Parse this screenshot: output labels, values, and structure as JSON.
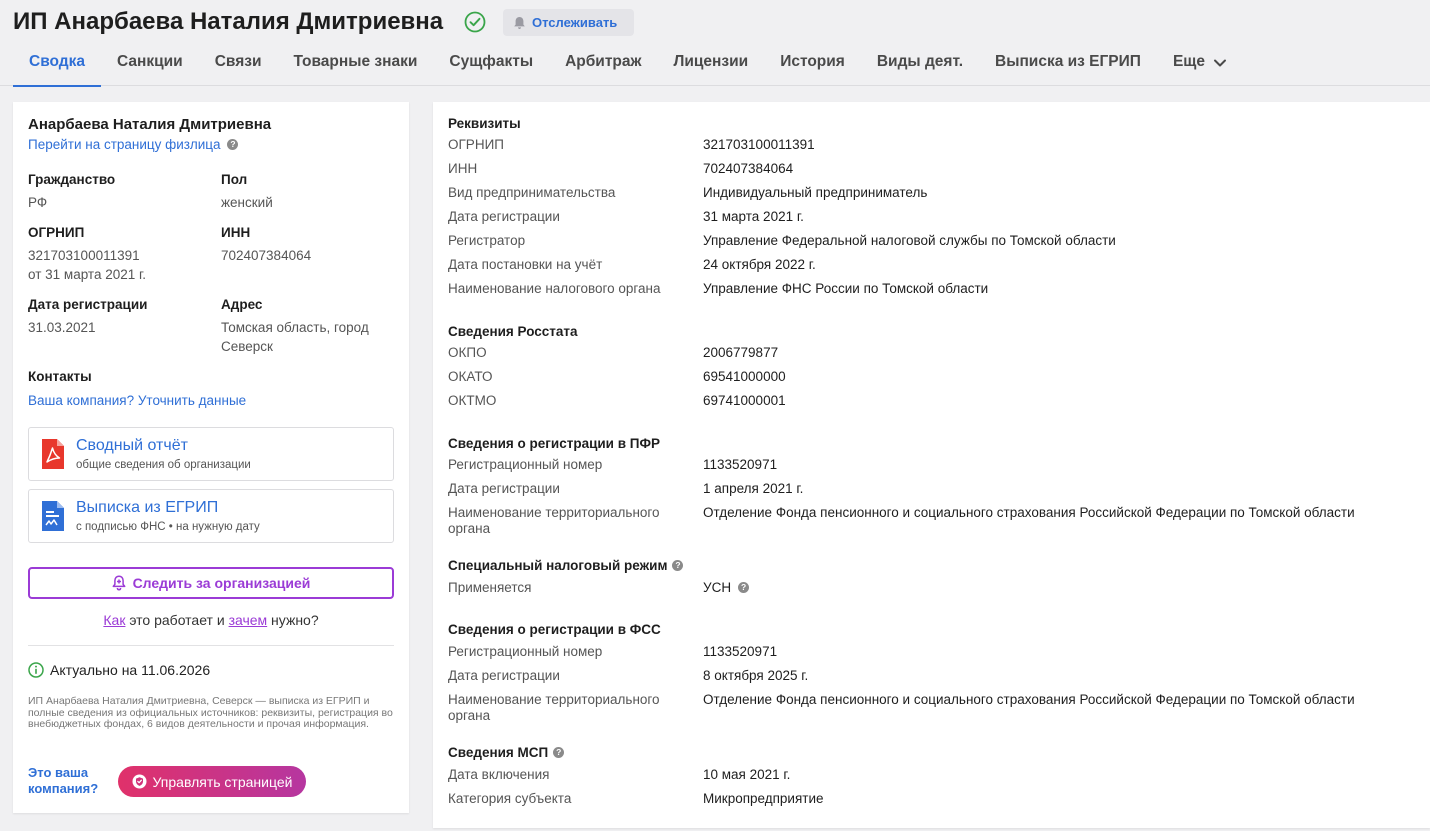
{
  "header": {
    "title": "ИП Анарбаева Наталия Дмитриевна",
    "track_label": "Отслеживать",
    "tabs": [
      "Сводка",
      "Санкции",
      "Связи",
      "Товарные знаки",
      "Сущфакты",
      "Арбитраж",
      "Лицензии",
      "История",
      "Виды деят.",
      "Выписка из ЕГРИП",
      "Еще"
    ],
    "active_tab": "Сводка"
  },
  "left": {
    "person_name": "Анарбаева Наталия Дмитриевна",
    "person_link": "Перейти на страницу физлица",
    "citizenship_label": "Гражданство",
    "citizenship_value": "РФ",
    "gender_label": "Пол",
    "gender_value": "женский",
    "ogrnip_label": "ОГРНИП",
    "ogrnip_value": "321703100011391",
    "ogrnip_date": "от 31 марта 2021 г.",
    "inn_label": "ИНН",
    "inn_value": "702407384064",
    "regdate_label": "Дата регистрации",
    "regdate_value": "31.03.2021",
    "address_label": "Адрес",
    "address_value": "Томская область, город Северск",
    "contacts_title": "Контакты",
    "contacts_link": "Ваша компания? Уточнить данные",
    "doc1_title": "Сводный отчёт",
    "doc1_sub": "общие сведения об организации",
    "doc2_title": "Выписка из ЕГРИП",
    "doc2_sub": "с подписью ФНС • на нужную дату",
    "follow_label": "Следить за организацией",
    "how_part1": "Как",
    "how_part2": " это работает и ",
    "how_part3": "зачем",
    "how_part4": " нужно?",
    "actual_text": "Актуально на 11.06.2026",
    "description": "ИП Анарбаева Наталия Дмитриевна, Северск — выписка из ЕГРИП и полные сведения из официальных источников: реквизиты, регистрация во внебюджетных фондах, 6 видов деятельности и прочая информация.",
    "own_question": "Это ваша компания?",
    "manage_label": "Управлять страницей"
  },
  "right": {
    "requisites": {
      "title": "Реквизиты",
      "rows": [
        {
          "label": "ОГРНИП",
          "value": "321703100011391"
        },
        {
          "label": "ИНН",
          "value": "702407384064"
        },
        {
          "label": "Вид предпринимательства",
          "value": "Индивидуальный предприниматель"
        },
        {
          "label": "Дата регистрации",
          "value": "31 марта 2021 г."
        },
        {
          "label": "Регистратор",
          "value": "Управление Федеральной налоговой службы по Томской области"
        },
        {
          "label": "Дата постановки на учёт",
          "value": "24 октября 2022 г."
        },
        {
          "label": "Наименование налогового органа",
          "value": "Управление ФНС России по Томской области"
        }
      ]
    },
    "rosstat": {
      "title": "Сведения Росстата",
      "rows": [
        {
          "label": "ОКПО",
          "value": "2006779877"
        },
        {
          "label": "ОКАТО",
          "value": "69541000000"
        },
        {
          "label": "ОКТМО",
          "value": "69741000001"
        }
      ]
    },
    "pfr": {
      "title": "Сведения о регистрации в ПФР",
      "rows": [
        {
          "label": "Регистрационный номер",
          "value": "1133520971"
        },
        {
          "label": "Дата регистрации",
          "value": "1 апреля 2021 г."
        },
        {
          "label": "Наименование территориального органа",
          "value": "Отделение Фонда пенсионного и социального страхования Российской Федерации по Томской области"
        }
      ]
    },
    "tax": {
      "title": "Специальный налоговый режим",
      "rows": [
        {
          "label": "Применяется",
          "value": "УСН"
        }
      ]
    },
    "fss": {
      "title": "Сведения о регистрации в ФСС",
      "rows": [
        {
          "label": "Регистрационный номер",
          "value": "1133520971"
        },
        {
          "label": "Дата регистрации",
          "value": "8 октября 2025 г."
        },
        {
          "label": "Наименование территориального органа",
          "value": "Отделение Фонда пенсионного и социального страхования Российской Федерации по Томской области"
        }
      ]
    },
    "msp": {
      "title": "Сведения МСП",
      "rows": [
        {
          "label": "Дата включения",
          "value": "10 мая 2021 г."
        },
        {
          "label": "Категория субъекта",
          "value": "Микропредприятие"
        }
      ]
    }
  },
  "colors": {
    "accent": "#2f6fd6",
    "purple": "#9b3bd6",
    "check_green": "#3aa54a",
    "pdf_red": "#e8372c",
    "doc_blue": "#2f6fd6"
  },
  "icons": {
    "verified": "check-circle-icon",
    "track": "bell-icon",
    "more": "chevron-down-icon",
    "help": "question-icon",
    "doc1": "pdf-icon",
    "doc2": "document-icon",
    "follow": "bell-plus-icon",
    "actual": "info-icon",
    "manage": "shield-icon"
  }
}
